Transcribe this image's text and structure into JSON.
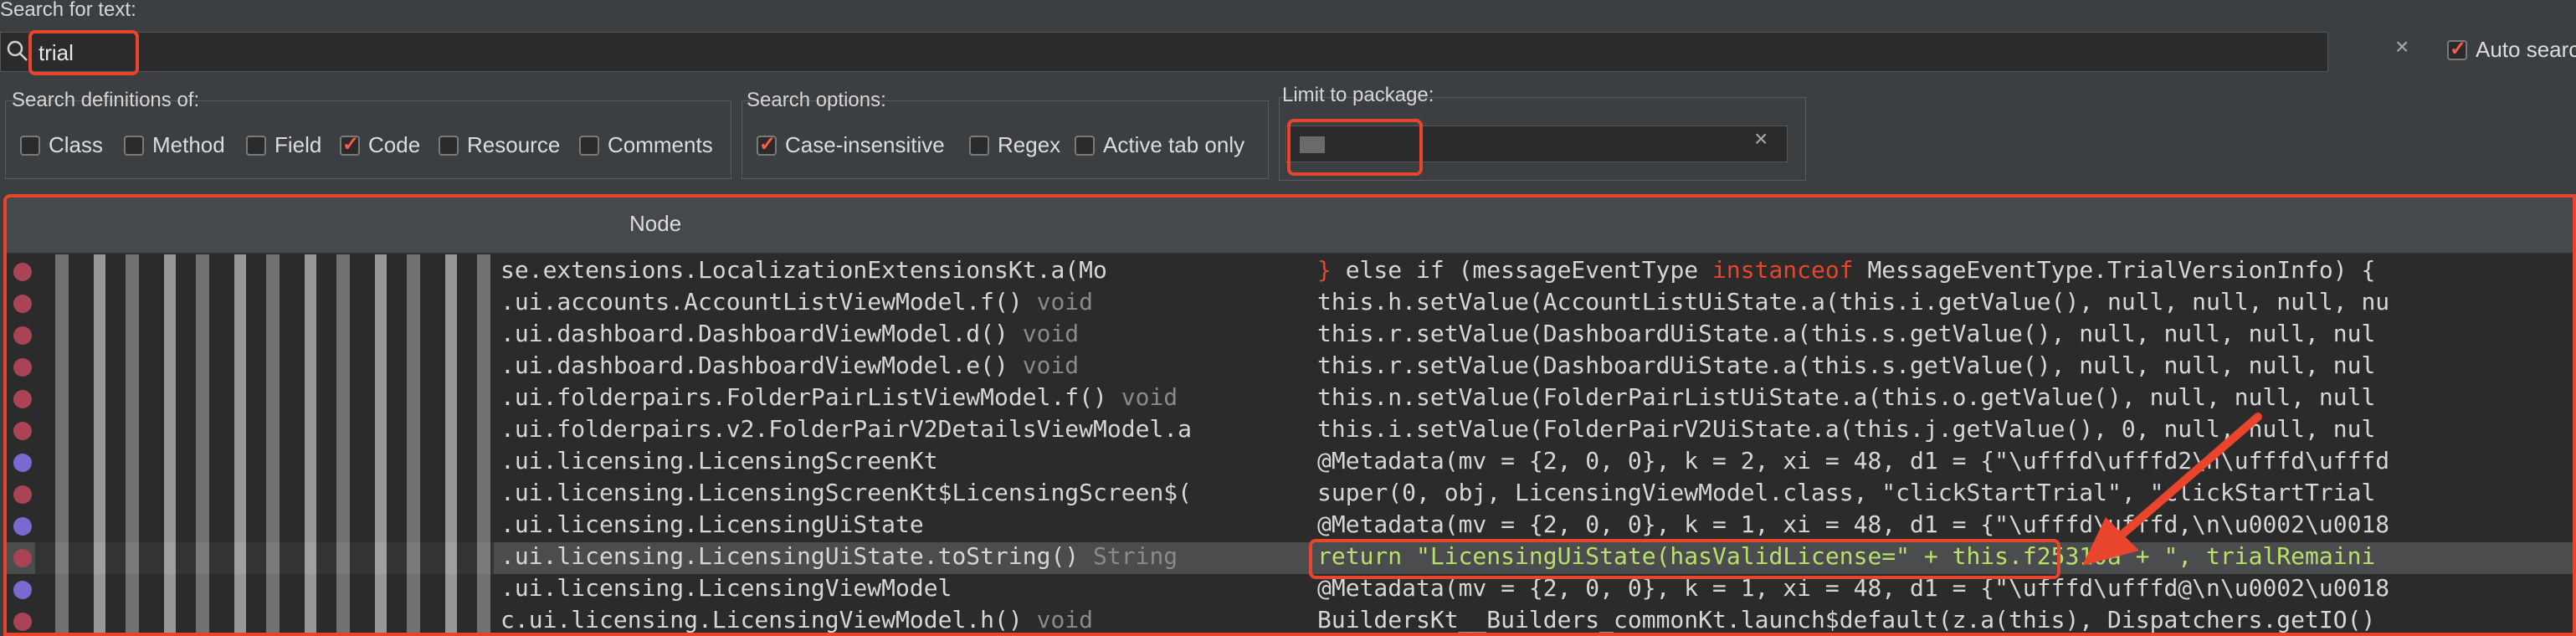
{
  "search": {
    "label": "Search for text:",
    "value": "trial",
    "auto_search_label": "Auto search"
  },
  "definitions": {
    "label": "Search definitions of:",
    "options": [
      {
        "label": "Class",
        "checked": false
      },
      {
        "label": "Method",
        "checked": false
      },
      {
        "label": "Field",
        "checked": false
      },
      {
        "label": "Code",
        "checked": true
      },
      {
        "label": "Resource",
        "checked": false
      },
      {
        "label": "Comments",
        "checked": false
      }
    ]
  },
  "search_options": {
    "label": "Search options:",
    "options": [
      {
        "label": "Case-insensitive",
        "checked": true
      },
      {
        "label": "Regex",
        "checked": false
      },
      {
        "label": "Active tab only",
        "checked": false
      }
    ]
  },
  "package": {
    "label": "Limit to package:",
    "value": ""
  },
  "results": {
    "header": "Node",
    "rows": [
      {
        "node": "se.extensions.LocalizationExtensionsKt.a(Mo",
        "ret": "",
        "code": "} else if (messageEventType instanceof MessageEventType.TrialVersionInfo) {"
      },
      {
        "node": ".ui.accounts.AccountListViewModel.f()",
        "ret": "void",
        "code": "this.h.setValue(AccountListUiState.a(this.i.getValue(), null, null, null, nu"
      },
      {
        "node": ".ui.dashboard.DashboardViewModel.d()",
        "ret": "void",
        "code": "this.r.setValue(DashboardUiState.a(this.s.getValue(), null, null, null, nul"
      },
      {
        "node": ".ui.dashboard.DashboardViewModel.e()",
        "ret": "void",
        "code": "this.r.setValue(DashboardUiState.a(this.s.getValue(), null, null, null, nul"
      },
      {
        "node": ".ui.folderpairs.FolderPairListViewModel.f()",
        "ret": "void",
        "code": "this.n.setValue(FolderPairListUiState.a(this.o.getValue(), null, null, null"
      },
      {
        "node": ".ui.folderpairs.v2.FolderPairV2DetailsViewModel.a",
        "ret": "",
        "code": "this.i.setValue(FolderPairV2UiState.a(this.j.getValue(), 0, null, null, nul"
      },
      {
        "node": ".ui.licensing.LicensingScreenKt",
        "ret": "",
        "code": "@Metadata(mv = {2, 0, 0}, k = 2, xi = 48, d1 = {\"\\ufffd\\ufffd2\\n\\ufffd\\ufffd"
      },
      {
        "node": ".ui.licensing.LicensingScreenKt$LicensingScreen$(",
        "ret": "",
        "code": "super(0, obj, LicensingViewModel.class, \"clickStartTrial\", \"clickStartTrial"
      },
      {
        "node": ".ui.licensing.LicensingUiState",
        "ret": "",
        "code": "@Metadata(mv = {2, 0, 0}, k = 1, xi = 48, d1 = {\"\\ufffd\\ufffd,\\n\\u0002\\u0018"
      },
      {
        "node": ".ui.licensing.LicensingUiState.toString()",
        "ret": "String",
        "code": "return \"LicensingUiState(hasValidLicense=\" + this.f25310a + \", trialRemaini"
      },
      {
        "node": ".ui.licensing.LicensingViewModel",
        "ret": "",
        "code": "@Metadata(mv = {2, 0, 0}, k = 1, xi = 48, d1 = {\"\\ufffd\\ufffd@\\n\\u0002\\u0018"
      },
      {
        "node": "c.ui.licensing.LicensingViewModel.h()",
        "ret": "void",
        "code": "BuildersKt__Builders_commonKt.launch$default(z.a(this), Dispatchers.getIO()"
      }
    ]
  },
  "colors": {
    "accent": "#e8452c",
    "background": "#3c3f41",
    "panel": "#2b2b2b"
  }
}
